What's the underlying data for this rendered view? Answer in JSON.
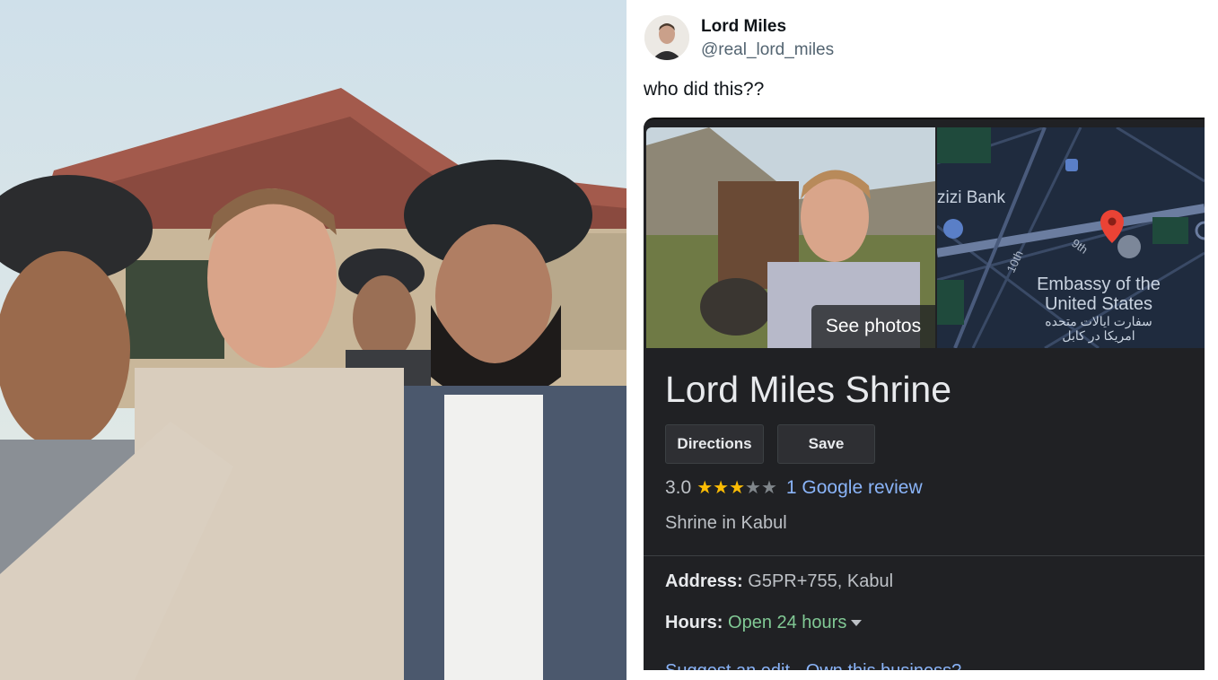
{
  "tweet": {
    "display_name": "Lord Miles",
    "handle": "@real_lord_miles",
    "text": "who did this??"
  },
  "card": {
    "see_photos_label": "See photos",
    "map": {
      "bank_label": "zizi Bank",
      "street_10th": "10th",
      "street_9th": "9th",
      "embassy_line1": "Embassy of the",
      "embassy_line2": "United States",
      "embassy_arabic_1": "سفارت ایالات متحده",
      "embassy_arabic_2": "امریکا در کابل"
    },
    "place_title": "Lord Miles Shrine",
    "directions_label": "Directions",
    "save_label": "Save",
    "rating_value": "3.0",
    "rating_stars": 3,
    "review_link": "1 Google review",
    "category": "Shrine in Kabul",
    "address_label": "Address:",
    "address_value": " G5PR+755, Kabul",
    "hours_label": "Hours:",
    "hours_value": " Open 24 hours",
    "cut_off_text": "Suggest an edit · Own this business?"
  },
  "colors": {
    "card_bg": "#202124",
    "link": "#8ab4f8",
    "open_green": "#81c995",
    "star": "#fbbc04",
    "map_bg": "#1f2b3e",
    "pin": "#ea4335"
  }
}
